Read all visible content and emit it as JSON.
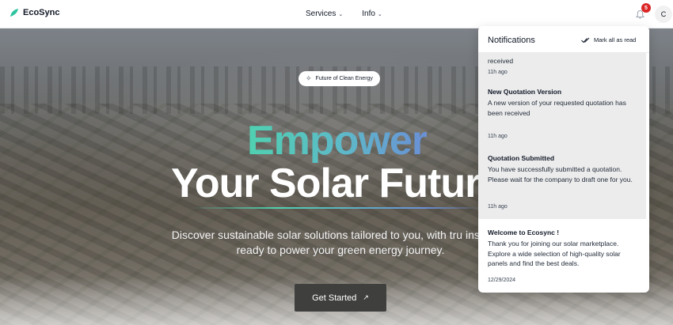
{
  "header": {
    "brand": "EcoSync",
    "nav": [
      {
        "label": "Services"
      },
      {
        "label": "Info"
      }
    ],
    "notification_count": "5",
    "avatar_initial": "C"
  },
  "hero": {
    "pill": "Future of Clean Energy",
    "headline_1": "Empower",
    "headline_2": "Your Solar Futur",
    "subtitle": "Discover sustainable solar solutions tailored to you, with tru installers ready to power your green energy journey.",
    "cta": "Get Started"
  },
  "notifications": {
    "title": "Notifications",
    "mark_all": "Mark all as read",
    "items": [
      {
        "title": "",
        "body": "received",
        "time": "11h ago",
        "unread": true
      },
      {
        "title": "New Quotation Version",
        "body": "A new version of your requested quotation has been received",
        "time": "11h ago",
        "unread": true
      },
      {
        "title": "Quotation Submitted",
        "body": "You have successfully submitted a quotation. Please wait for the company to draft one for you.",
        "time": "11h ago",
        "unread": true
      },
      {
        "title": "Welcome to Ecosync !",
        "body": "Thank you for joining our solar marketplace. Explore a wide selection of high-quality solar panels and find the best deals.",
        "time": "12/29/2024",
        "unread": false
      }
    ]
  },
  "colors": {
    "brand_teal": "#4fd1b0",
    "gradient_blue": "#6a8fd6",
    "badge_red": "#dc2626",
    "cta_bg": "#3f3f3d"
  }
}
